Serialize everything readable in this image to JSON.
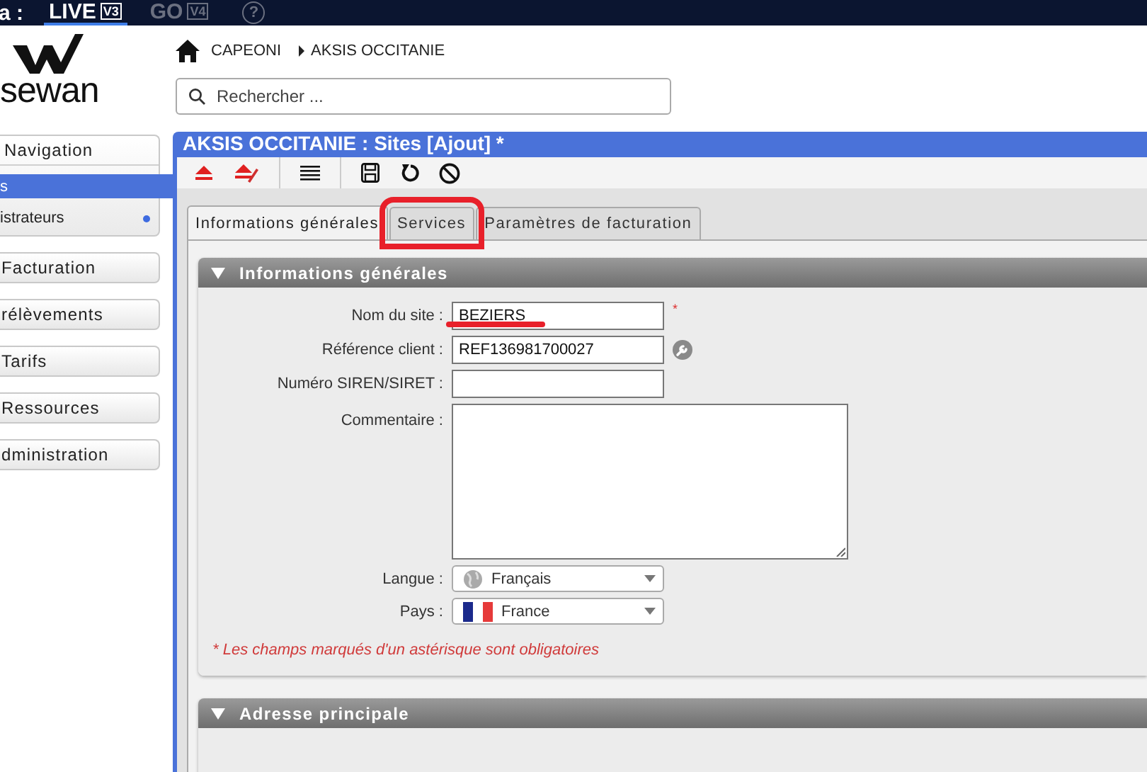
{
  "top_bar": {
    "cut_label": "a :",
    "environments": [
      {
        "label": "LIVE",
        "version": "V3",
        "selected": true
      },
      {
        "label": "GO",
        "version": "V4",
        "selected": false
      }
    ],
    "help": "?"
  },
  "logo": {
    "text": "sewan"
  },
  "breadcrumb": [
    "CAPEONI",
    "AKSIS OCCITANIE"
  ],
  "search": {
    "placeholder": "Rechercher ..."
  },
  "sidebar": {
    "items": [
      {
        "label": "Navigation",
        "kind": "group",
        "children": [
          {
            "label": "s",
            "selected": true,
            "dot": false
          },
          {
            "label": "istrateurs",
            "selected": false,
            "dot": true
          }
        ]
      },
      {
        "label": "Facturation",
        "kind": "button"
      },
      {
        "label": "rélèvements",
        "kind": "button"
      },
      {
        "label": "Tarifs",
        "kind": "button"
      },
      {
        "label": "Ressources",
        "kind": "button"
      },
      {
        "label": "dministration",
        "kind": "button"
      }
    ]
  },
  "panel": {
    "title": "AKSIS OCCITANIE : Sites [Ajout] *",
    "tabs": [
      {
        "label": "Informations générales",
        "selected": true,
        "highlighted": false
      },
      {
        "label": "Services",
        "selected": false,
        "highlighted": true
      },
      {
        "label": "Paramètres de facturation",
        "selected": false,
        "highlighted": false
      }
    ],
    "sections": [
      {
        "title": "Informations générales",
        "expanded": true,
        "fields": [
          {
            "kind": "text",
            "label": "Nom du site :",
            "value": "BEZIERS",
            "marker": "*",
            "tool": false,
            "underlined": true
          },
          {
            "kind": "text",
            "label": "Référence client :",
            "value": "REF136981700027",
            "tool": true,
            "underlined": false
          },
          {
            "kind": "text",
            "label": "Numéro SIREN/SIRET :",
            "tool": false,
            "underlined": false
          },
          {
            "kind": "textarea",
            "label": "Commentaire :"
          },
          {
            "kind": "language",
            "label": "Langue :",
            "value": "Français"
          },
          {
            "kind": "country",
            "label": "Pays :",
            "value": "France"
          }
        ],
        "note": "* Les champs marqués d'un astérisque sont obligatoires"
      },
      {
        "title": "Adresse principale",
        "expanded": true
      }
    ]
  }
}
